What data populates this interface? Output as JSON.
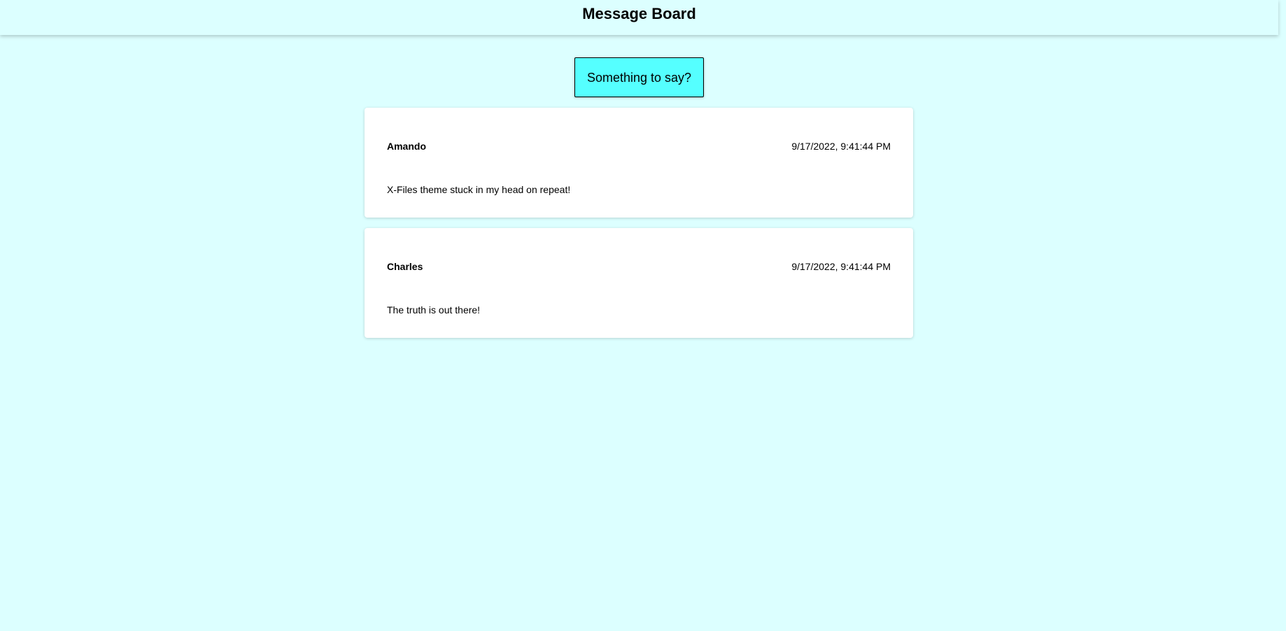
{
  "header": {
    "title": "Message Board"
  },
  "compose": {
    "label": "Something to say?"
  },
  "messages": [
    {
      "author": "Amando",
      "timestamp": "9/17/2022, 9:41:44 PM",
      "text": "X-Files theme stuck in my head on repeat!"
    },
    {
      "author": "Charles",
      "timestamp": "9/17/2022, 9:41:44 PM",
      "text": "The truth is out there!"
    }
  ],
  "colors": {
    "background": "#dcffff",
    "button": "#55ffff",
    "card": "#ffffff"
  }
}
